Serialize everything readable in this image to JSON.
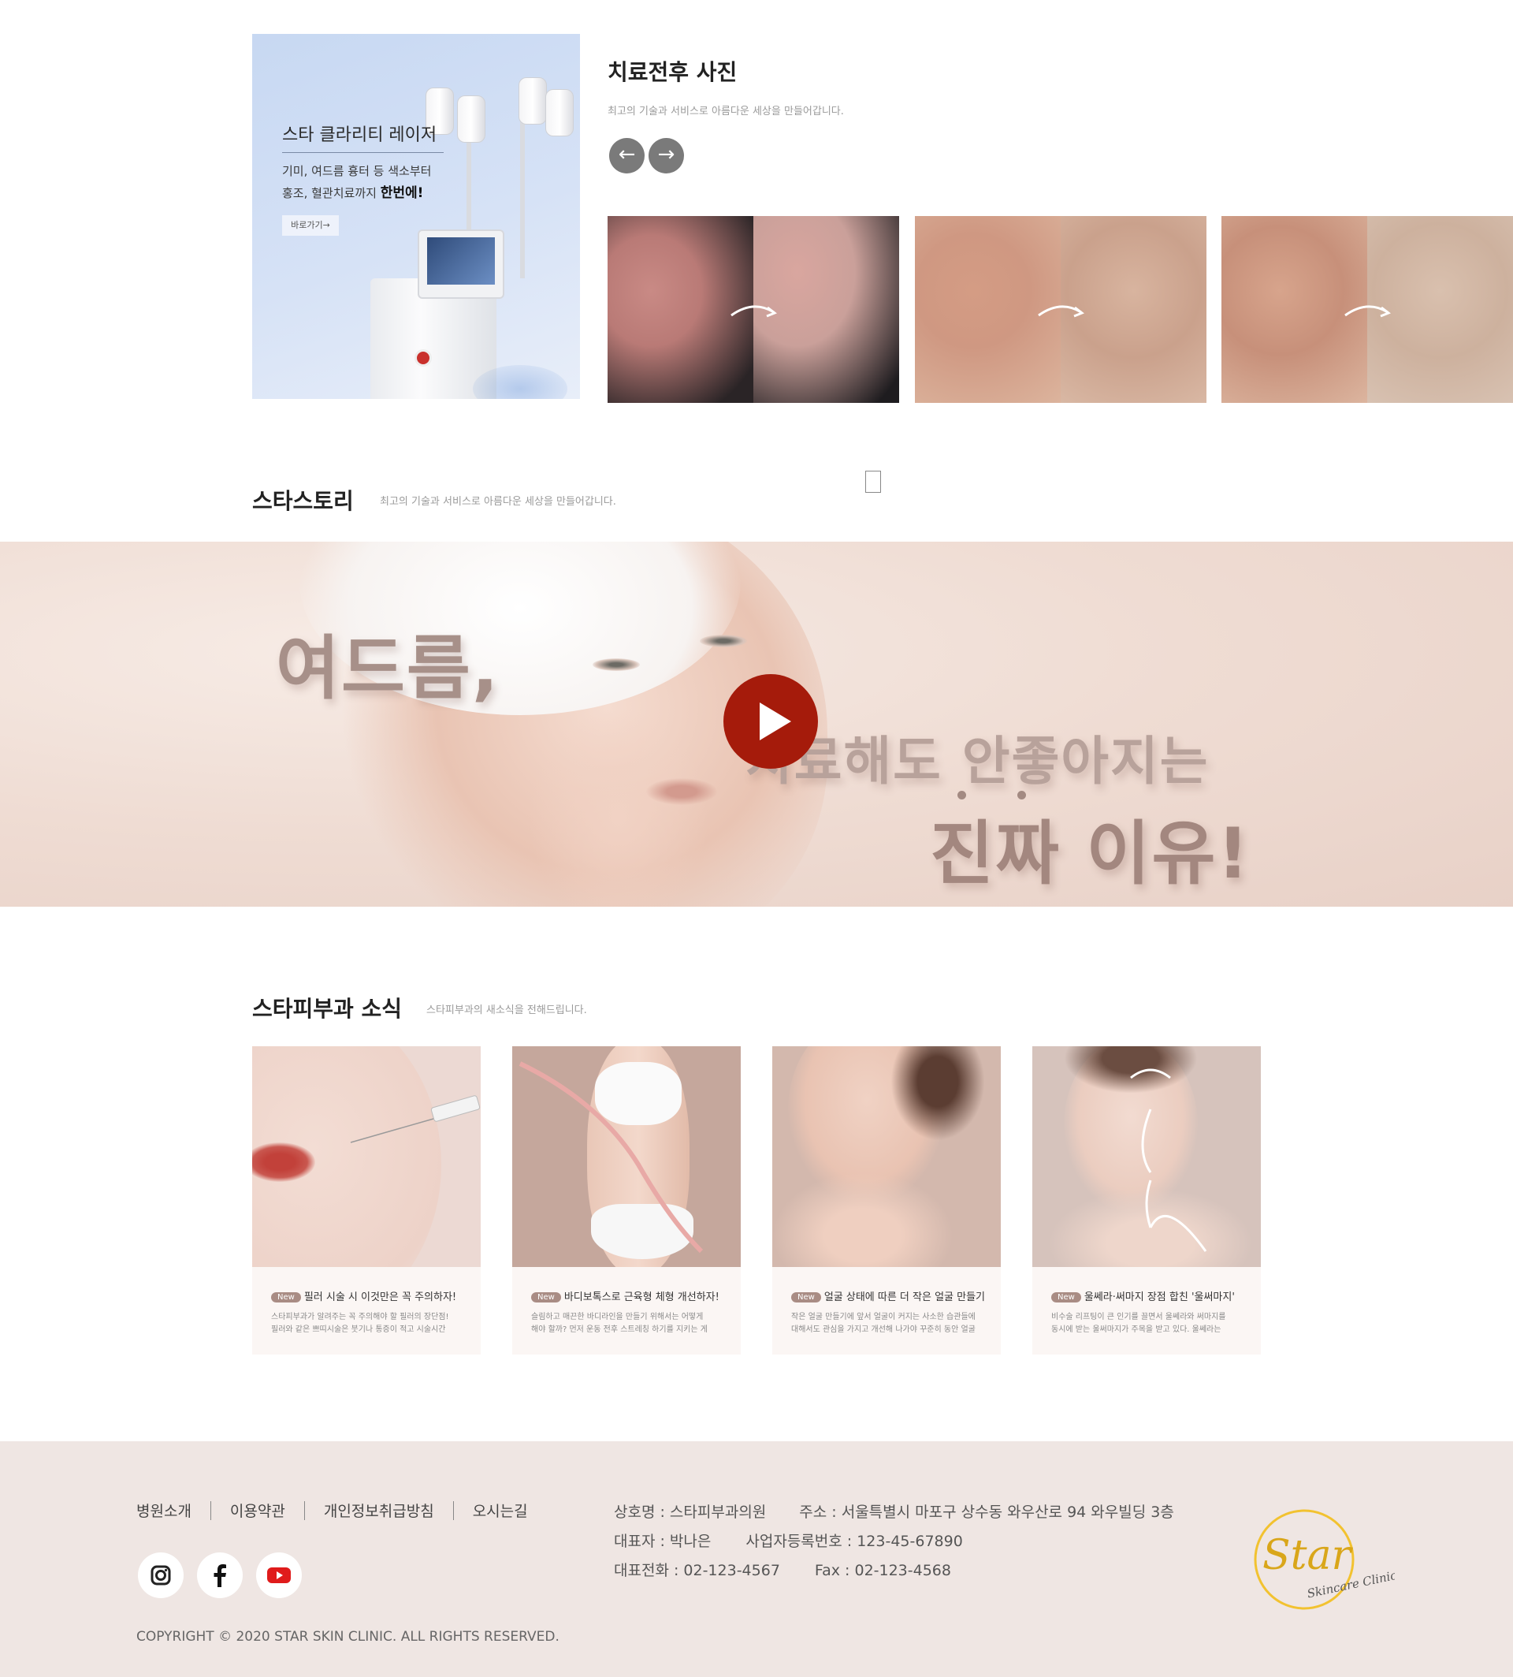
{
  "promo": {
    "title": "스타 클라리티 레이저",
    "desc_line1": "기미, 여드름 흉터 등 색소부터",
    "desc_line2_prefix": "홍조, 혈관치료까지 ",
    "desc_line2_bold": "한번에!",
    "button": "바로가기→"
  },
  "before_after": {
    "title": "치료전후 사진",
    "subtitle": "최고의 기술과 서비스로 아름다운 세상을 만들어갑니다.",
    "prev_icon": "arrow-left-icon",
    "next_icon": "arrow-right-icon",
    "prev_glyph": "←",
    "next_glyph": "→"
  },
  "story": {
    "title": "스타스토리",
    "subtitle": "최고의 기술과 서비스로 아름다운 세상을 만들어갑니다.",
    "video_line1": "여드름,",
    "video_line2": "치료해도 안좋아지는",
    "video_line3": "진짜 이유!"
  },
  "news": {
    "title": "스타피부과 소식",
    "subtitle": "스타피부과의 새소식을 전해드립니다.",
    "badge": "New",
    "cards": [
      {
        "title": "필러 시술 시 이것만은 꼭 주의하자!",
        "desc1": "스타피부과가 알려주는 꼭 주의해야 할 필러의 장단점!",
        "desc2": "필러와 같은 쁘띠시술은 붓기나 통증이 적고 시술시간"
      },
      {
        "title": "바디보톡스로 근육형 체형 개선하자!",
        "desc1": "슬림하고 매끈한 바디라인을 만들기 위해서는 어떻게",
        "desc2": "해야 할까? 먼저 운동 전후 스트레칭 하기를 지키는 게"
      },
      {
        "title": "얼굴 상태에 따른 더 작은 얼굴 만들기",
        "desc1": "작은 얼굴 만들기에 앞서 얼굴이 커지는 사소한 습관들에",
        "desc2": "대해서도 관심을 가지고 개선해 나가야 꾸준히 동안 얼굴"
      },
      {
        "title": "울쎄라·써마지 장점 합친 '울써마지'",
        "desc1": "비수술 리프팅이 큰 인기를 끌면서 울쎄라와 써마지를",
        "desc2": "동시에 받는 울써마지가 주목을 받고 있다. 울쎄라는"
      }
    ]
  },
  "footer": {
    "nav": [
      "병원소개",
      "이용약관",
      "개인정보취급방침",
      "오시는길"
    ],
    "company": "상호명 : 스타피부과의원",
    "address": "주소 : 서울특별시 마포구 상수동 와우산로 94 와우빌딩 3층",
    "ceo": "대표자 : 박나은",
    "biz_no": "사업자등록번호 : 123-45-67890",
    "phone": "대표전화 : 02-123-4567",
    "fax": "Fax : 02-123-4568",
    "copyright": "COPYRIGHT © 2020 STAR SKIN CLINIC. ALL RIGHTS RESERVED.",
    "logo_word": "Star",
    "logo_sub": "Skincare Clinic",
    "social": [
      "instagram-icon",
      "facebook-icon",
      "youtube-icon"
    ]
  },
  "colors": {
    "accent_red": "#a51b0b",
    "footer_bg": "#efe6e3",
    "badge": "#a98c84",
    "logo_gold": "#f2c230"
  }
}
